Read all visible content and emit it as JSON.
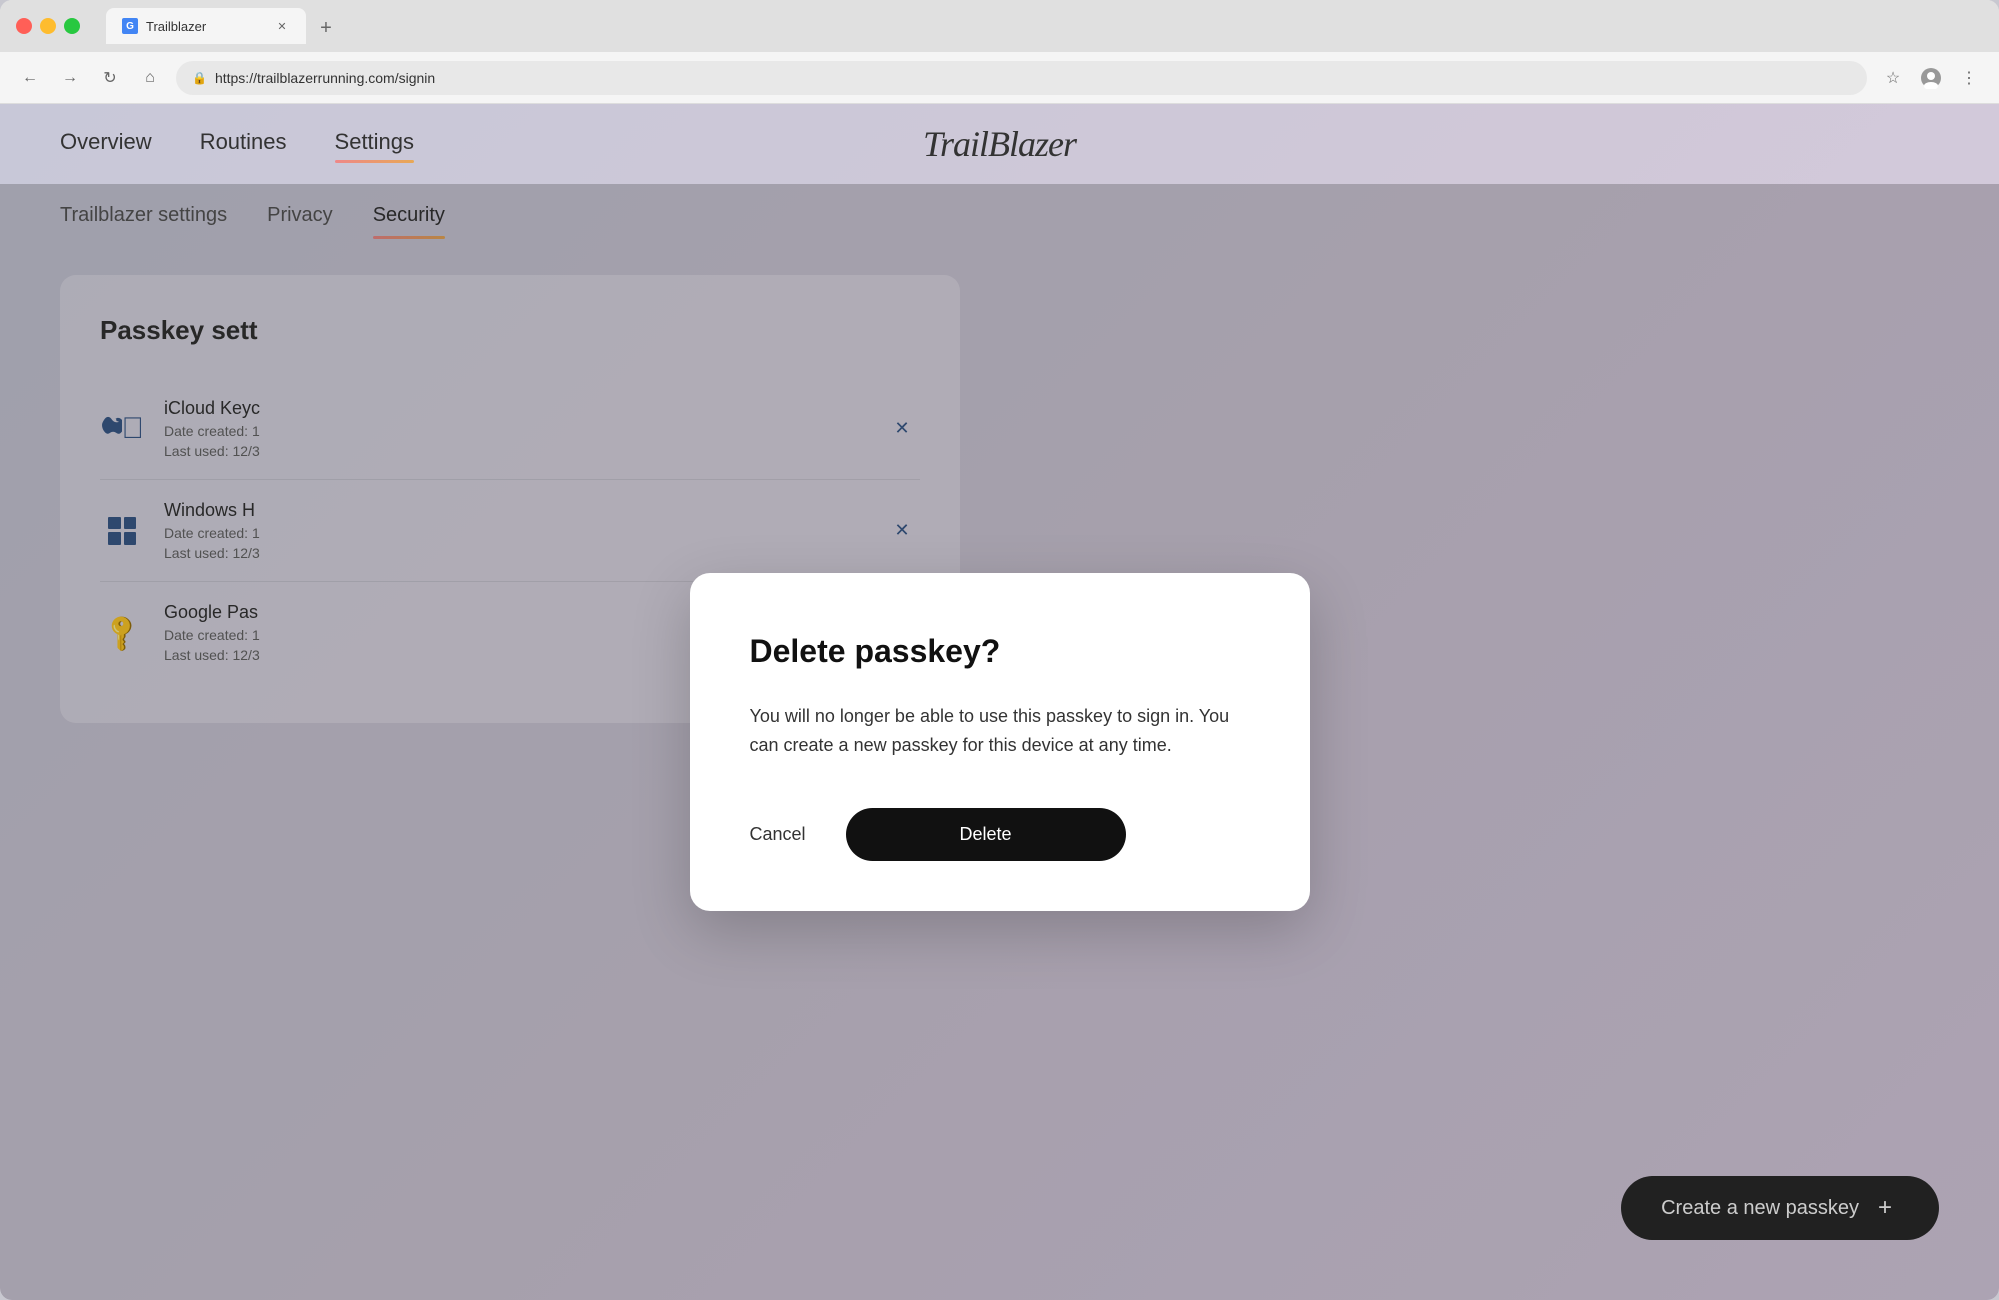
{
  "browser": {
    "tab_title": "Trailblazer",
    "tab_favicon": "G",
    "url": "https://trailblazerrunning.com/signin",
    "new_tab_label": "+"
  },
  "nav": {
    "links": [
      {
        "label": "Overview",
        "active": false
      },
      {
        "label": "Routines",
        "active": false
      },
      {
        "label": "Settings",
        "active": true
      }
    ],
    "logo": "TrailBlazer"
  },
  "settings_tabs": [
    {
      "label": "Trailblazer settings",
      "active": false
    },
    {
      "label": "Privacy",
      "active": false
    },
    {
      "label": "Security",
      "active": true
    }
  ],
  "passkey_section": {
    "title": "Passkey sett",
    "items": [
      {
        "name": "iCloud Keyc",
        "date_created": "Date created: 1",
        "last_used": "Last used: 12/3",
        "icon_type": "apple"
      },
      {
        "name": "Windows H",
        "date_created": "Date created: 1",
        "last_used": "Last used: 12/3",
        "icon_type": "windows"
      },
      {
        "name": "Google Pas",
        "date_created": "Date created: 1",
        "last_used": "Last used: 12/3",
        "icon_type": "key"
      }
    ]
  },
  "create_passkey_btn": {
    "label": "Create a new passkey",
    "icon": "+"
  },
  "modal": {
    "title": "Delete passkey?",
    "body": "You will no longer be able to use this passkey to sign in. You can create a new passkey for this device at any time.",
    "cancel_label": "Cancel",
    "delete_label": "Delete"
  }
}
